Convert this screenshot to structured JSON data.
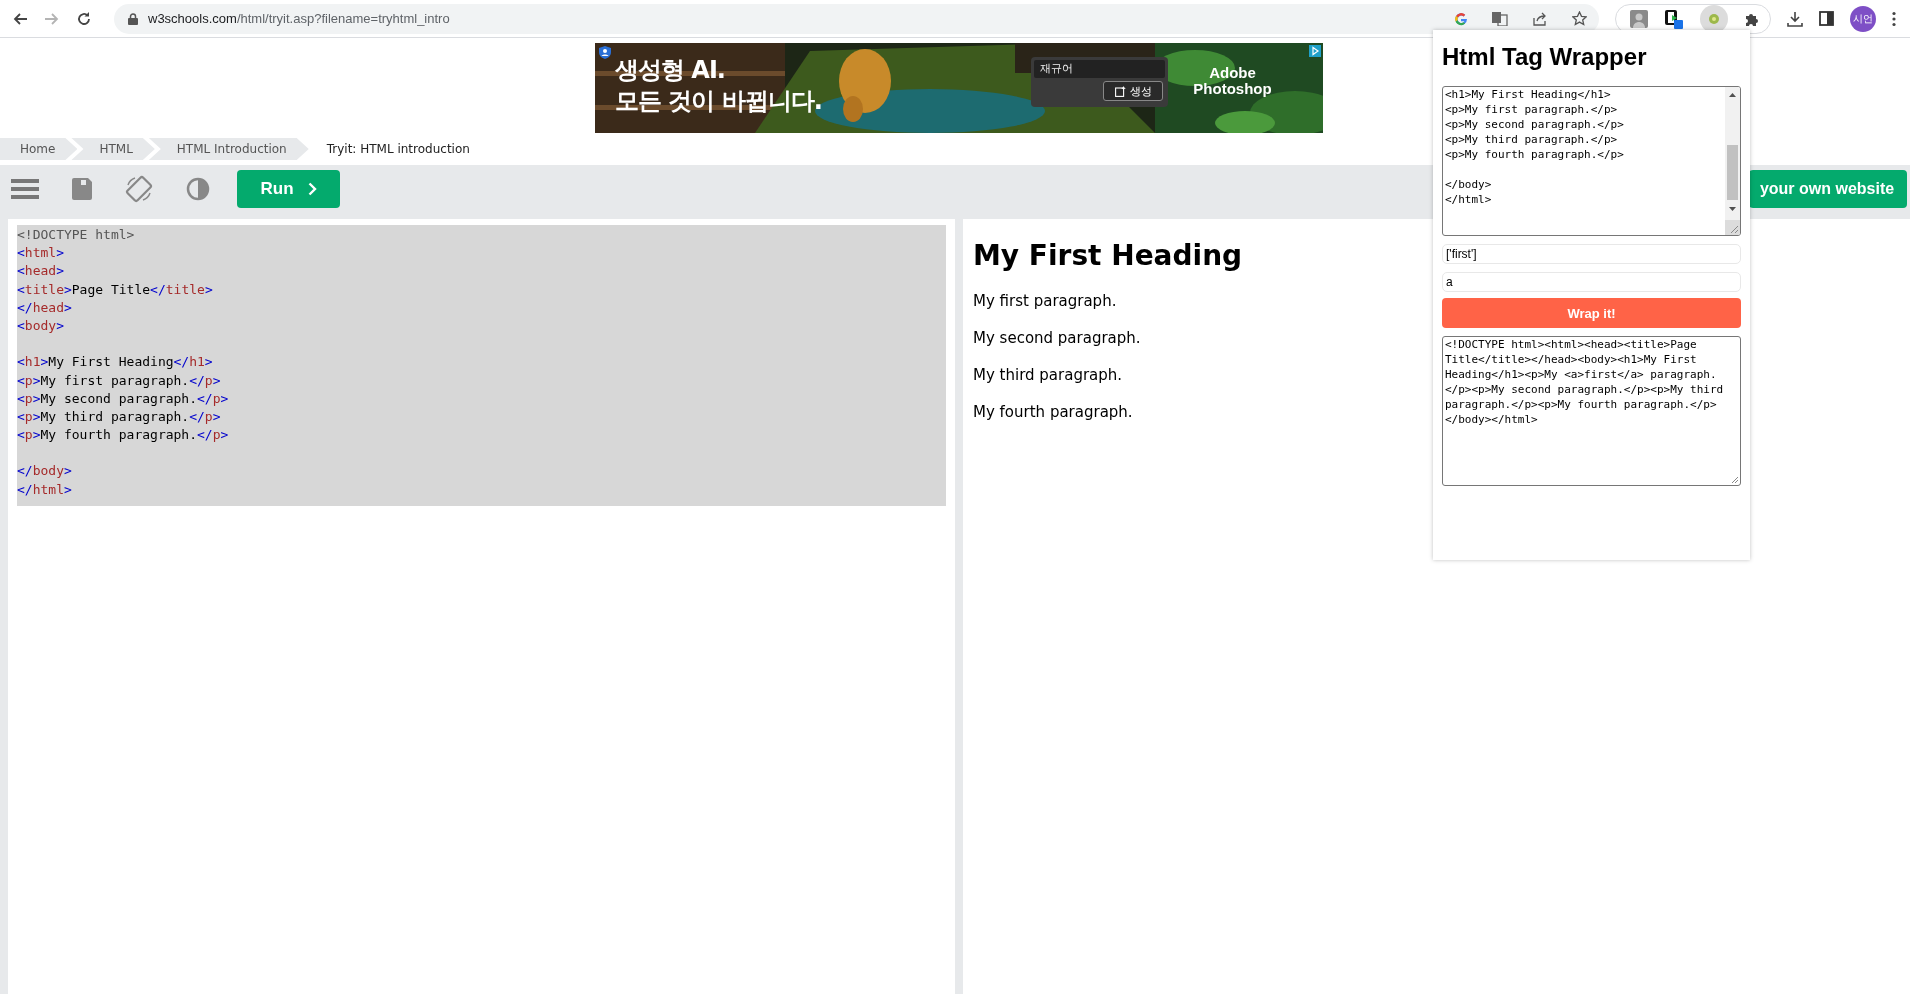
{
  "browser": {
    "nav_buttons": [
      {
        "kind": "back",
        "disabled": false
      },
      {
        "kind": "forward",
        "disabled": true
      },
      {
        "kind": "reload",
        "disabled": false
      }
    ],
    "url": {
      "host": "w3schools.com",
      "path": "/html/tryit.asp?filename=tryhtml_intro"
    },
    "profile_avatar": "시언"
  },
  "ad": {
    "headline": [
      "생성형 AI.",
      "모든 것이 바뀝니다."
    ],
    "prompt_value": "재규어",
    "generate_button": "생성",
    "brand": "Adobe Photoshop"
  },
  "breadcrumb": [
    {
      "label": "Home",
      "current": false
    },
    {
      "label": "HTML",
      "current": false
    },
    {
      "label": "HTML Introduction",
      "current": false
    },
    {
      "label": "Tryit: HTML introduction",
      "current": true
    }
  ],
  "toolbar": {
    "run_button": "Run",
    "website_button": "your own website"
  },
  "code_editor": {
    "lines": [
      {
        "kind": "code",
        "text": "<!DOCTYPE html>"
      },
      {
        "kind": "code",
        "text": "<html>"
      },
      {
        "kind": "code",
        "text": "<head>"
      },
      {
        "kind": "code",
        "text": "<title>Page Title</title>"
      },
      {
        "kind": "code",
        "text": "</head>"
      },
      {
        "kind": "code",
        "text": "<body>"
      },
      {
        "kind": "blank"
      },
      {
        "kind": "code",
        "text": "<h1>My First Heading</h1>"
      },
      {
        "kind": "code",
        "text": "<p>My first paragraph.</p>"
      },
      {
        "kind": "code",
        "text": "<p>My second paragraph.</p>"
      },
      {
        "kind": "code",
        "text": "<p>My third paragraph.</p>"
      },
      {
        "kind": "code",
        "text": "<p>My fourth paragraph.</p>"
      },
      {
        "kind": "blank"
      },
      {
        "kind": "code",
        "text": "</body>"
      },
      {
        "kind": "code",
        "text": "</html>"
      }
    ]
  },
  "result": {
    "heading": "My First Heading",
    "paragraphs": [
      "My first paragraph.",
      "My second paragraph.",
      "My third paragraph.",
      "My fourth paragraph."
    ]
  },
  "extension_popup": {
    "title": "Html Tag Wrapper",
    "source_text": "<h1>My First Heading</h1>\n<p>My first paragraph.</p>\n<p>My second paragraph.</p>\n<p>My third paragraph.</p>\n<p>My fourth paragraph.</p>\n\n</body>\n</html>",
    "words_field": "['first']",
    "tag_field": "a",
    "wrap_button": "Wrap it!",
    "output_text": "<!DOCTYPE html><html><head><title>Page Title</title></head><body><h1>My First Heading</h1><p>My <a>first</a> paragraph.</p><p>My second paragraph.</p><p>My third paragraph.</p><p>My fourth paragraph.</p></body></html>"
  }
}
